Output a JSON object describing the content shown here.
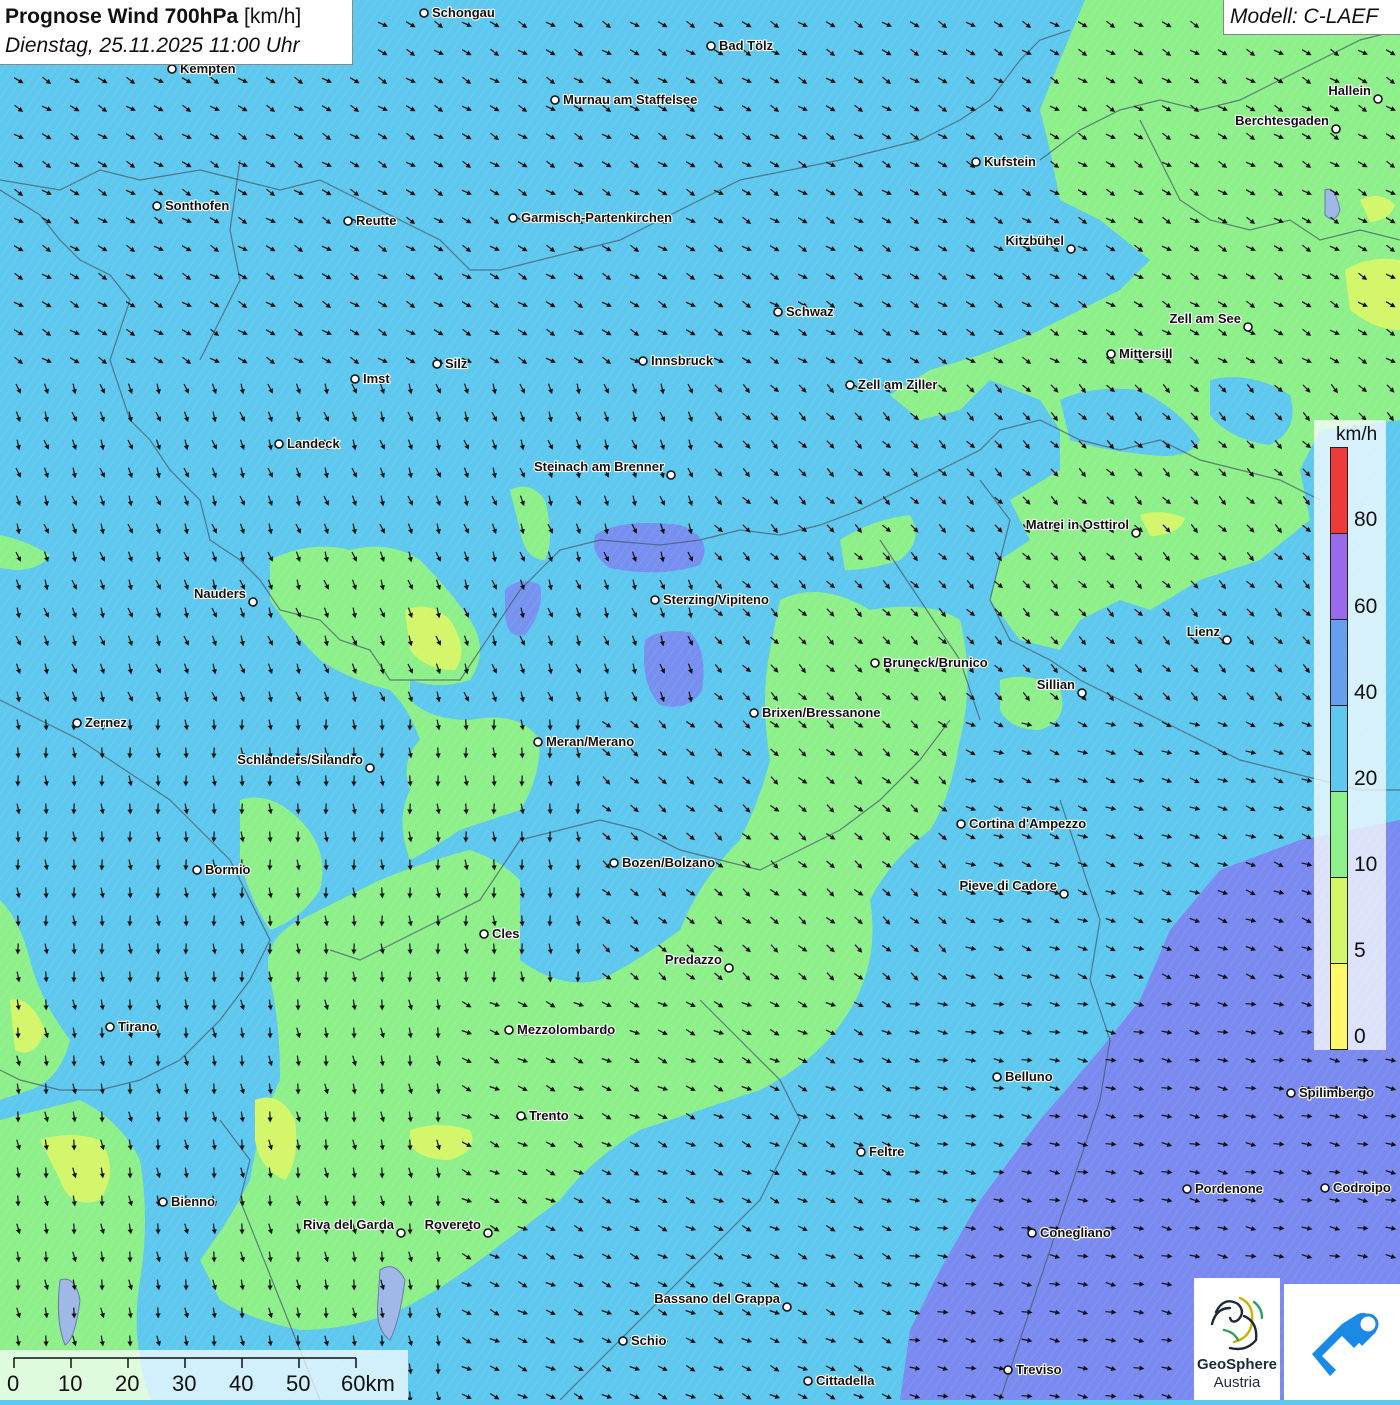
{
  "title": {
    "bold": "Prognose Wind 700hPa",
    "unit": " [km/h]",
    "datetime": "Dienstag, 25.11.2025 11:00 Uhr"
  },
  "model": "Modell: C-LAEF",
  "legend": {
    "unit": "km/h",
    "ticks": [
      "0",
      "5",
      "10",
      "20",
      "40",
      "60",
      "80"
    ],
    "colors": [
      "#fff86a",
      "#d4f66a",
      "#8ef08a",
      "#5ec8ef",
      "#64a0ee",
      "#9a6aee",
      "#f03a3a"
    ]
  },
  "field_colors": {
    "blue_20_40": "#5ec8ef",
    "green_10_20": "#8ef08a",
    "yellow_green_5_10": "#d4f66a",
    "purple_blue_40_60": "#7a8af0"
  },
  "wind": {
    "dominant_direction": "north-west",
    "arrow_color": "#111111"
  },
  "scale_bar": {
    "labels": [
      "0",
      "10",
      "20",
      "30",
      "40",
      "50",
      "60km"
    ]
  },
  "cities": [
    {
      "name": "Schongau",
      "label_side": "right"
    },
    {
      "name": "Bad Tölz",
      "label_side": "right"
    },
    {
      "name": "Kempten",
      "label_side": "right"
    },
    {
      "name": "Murnau am Staffelsee",
      "label_side": "right"
    },
    {
      "name": "Hallein",
      "label_side": "left"
    },
    {
      "name": "Berchtesgaden",
      "label_side": "left"
    },
    {
      "name": "Kufstein",
      "label_side": "right"
    },
    {
      "name": "Sonthofen",
      "label_side": "right"
    },
    {
      "name": "Reutte",
      "label_side": "right"
    },
    {
      "name": "Garmisch-Partenkirchen",
      "label_side": "right"
    },
    {
      "name": "Kitzbühel",
      "label_side": "left"
    },
    {
      "name": "Schwaz",
      "label_side": "right"
    },
    {
      "name": "Zell am See",
      "label_side": "left"
    },
    {
      "name": "Innsbruck",
      "label_side": "right"
    },
    {
      "name": "Mittersill",
      "label_side": "right"
    },
    {
      "name": "Silz",
      "label_side": "right"
    },
    {
      "name": "Imst",
      "label_side": "right"
    },
    {
      "name": "Zell am Ziller",
      "label_side": "right"
    },
    {
      "name": "Landeck",
      "label_side": "right"
    },
    {
      "name": "Steinach am Brenner",
      "label_side": "left"
    },
    {
      "name": "Matrei in Osttirol",
      "label_side": "left"
    },
    {
      "name": "Nauders",
      "label_side": "left"
    },
    {
      "name": "Sterzing/Vipiteno",
      "label_side": "right"
    },
    {
      "name": "Lienz",
      "label_side": "left"
    },
    {
      "name": "Bruneck/Brunico",
      "label_side": "right"
    },
    {
      "name": "Sillian",
      "label_side": "left"
    },
    {
      "name": "Brixen/Bressanone",
      "label_side": "right"
    },
    {
      "name": "Zernez",
      "label_side": "right"
    },
    {
      "name": "Meran/Merano",
      "label_side": "right"
    },
    {
      "name": "Schlanders/Silandro",
      "label_side": "left"
    },
    {
      "name": "Cortina d'Ampezzo",
      "label_side": "right"
    },
    {
      "name": "Bozen/Bolzano",
      "label_side": "right"
    },
    {
      "name": "Bormio",
      "label_side": "right"
    },
    {
      "name": "Pieve di Cadore",
      "label_side": "left"
    },
    {
      "name": "Cles",
      "label_side": "right"
    },
    {
      "name": "Predazzo",
      "label_side": "left"
    },
    {
      "name": "Tirano",
      "label_side": "right"
    },
    {
      "name": "Mezzolombardo",
      "label_side": "right"
    },
    {
      "name": "Belluno",
      "label_side": "right"
    },
    {
      "name": "Spilimbergo",
      "label_side": "right"
    },
    {
      "name": "Trento",
      "label_side": "right"
    },
    {
      "name": "Feltre",
      "label_side": "right"
    },
    {
      "name": "Bienno",
      "label_side": "right"
    },
    {
      "name": "Pordenone",
      "label_side": "right"
    },
    {
      "name": "Codroipo",
      "label_side": "right"
    },
    {
      "name": "Riva del Garda",
      "label_side": "left"
    },
    {
      "name": "Rovereto",
      "label_side": "left"
    },
    {
      "name": "Conegliano",
      "label_side": "right"
    },
    {
      "name": "Bassano del Grappa",
      "label_side": "left"
    },
    {
      "name": "Schio",
      "label_side": "right"
    },
    {
      "name": "Treviso",
      "label_side": "right"
    },
    {
      "name": "Cittadella",
      "label_side": "right"
    }
  ],
  "logos": {
    "geosphere_line1": "GeoSphere",
    "geosphere_line2": "Austria"
  }
}
